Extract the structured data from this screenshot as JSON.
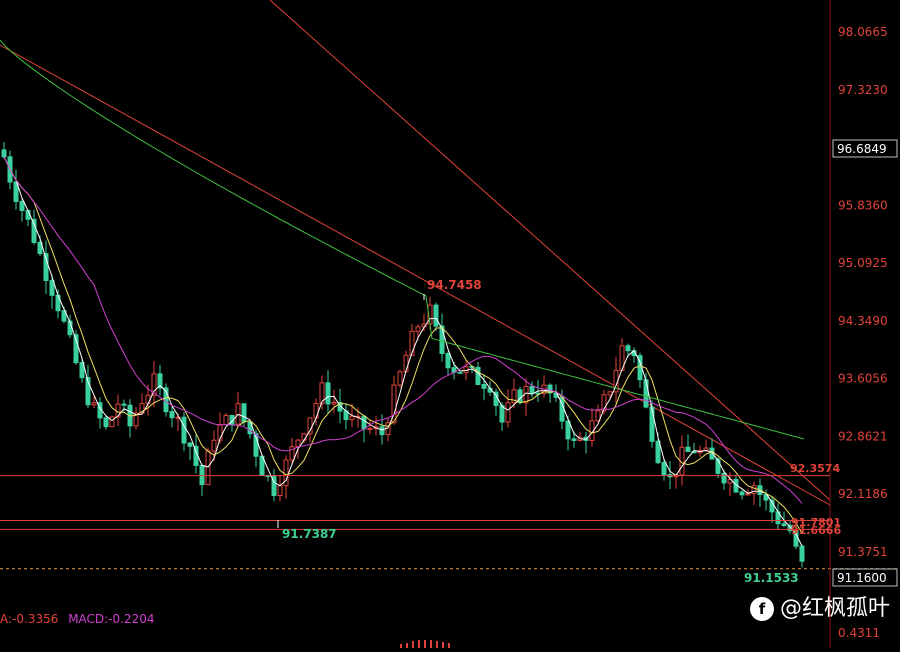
{
  "chart_data": {
    "type": "candlestick",
    "y_axis_ticks": [
      "98.0665",
      "97.3230",
      "96.6849",
      "95.8360",
      "95.0925",
      "94.3490",
      "93.6056",
      "92.8621",
      "92.1186",
      "91.3751",
      "91.1600",
      "0.4311"
    ],
    "current_price_box": "96.6849",
    "last_price_box": "91.1600",
    "annotations": {
      "high": "94.7458",
      "low_left": "91.7387",
      "low_right": "91.1533",
      "level_1": "92.3574",
      "level_2": "91.7801",
      "level_3": "91.6666"
    },
    "macd": {
      "a_label": "A:-0.3356",
      "macd_label": "MACD:-0.2204"
    },
    "ylim": [
      91.0,
      98.2
    ]
  },
  "watermark": {
    "logo_glyph": "f",
    "text": "@红枫孤叶"
  },
  "colors": {
    "up": "#e0433a",
    "down": "#3ad0a0",
    "ma5": "#ffffff",
    "ma10": "#f0e060",
    "ma20": "#d040d0",
    "ma60": "#40c040",
    "level": "#e0433a"
  }
}
